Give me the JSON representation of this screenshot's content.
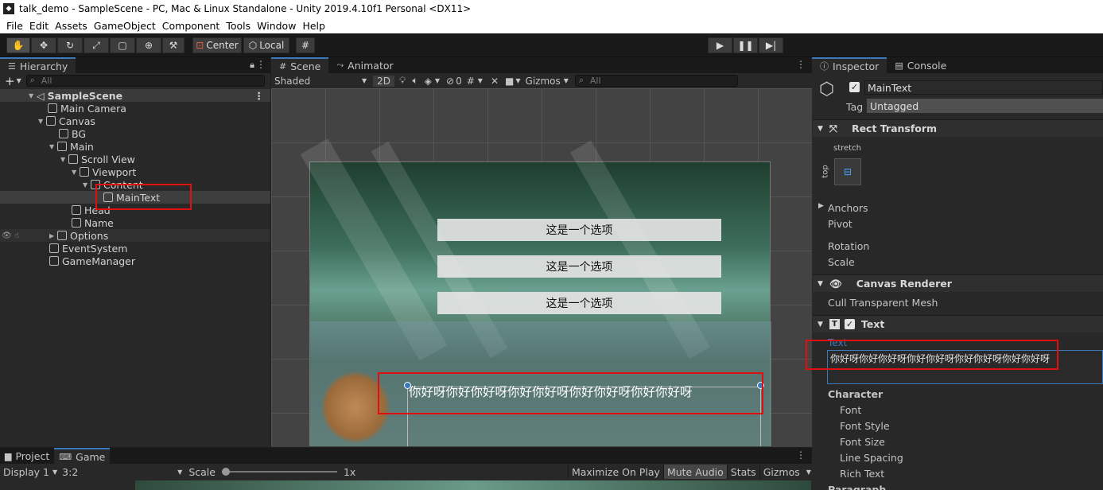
{
  "window": {
    "title": "talk_demo - SampleScene - PC, Mac & Linux Standalone - Unity 2019.4.10f1 Personal <DX11>"
  },
  "menu": [
    "File",
    "Edit",
    "Assets",
    "GameObject",
    "Component",
    "Tools",
    "Window",
    "Help"
  ],
  "toolbar": {
    "center_label": "Center",
    "local_label": "Local"
  },
  "hierarchy": {
    "tab": "Hierarchy",
    "add": "+",
    "search_placeholder": "All",
    "scene": "SampleScene",
    "items": [
      {
        "label": "Main Camera"
      },
      {
        "label": "Canvas"
      },
      {
        "label": "BG"
      },
      {
        "label": "Main"
      },
      {
        "label": "Scroll View"
      },
      {
        "label": "Viewport"
      },
      {
        "label": "Content"
      },
      {
        "label": "MainText"
      },
      {
        "label": "Head"
      },
      {
        "label": "Name"
      },
      {
        "label": "Options"
      },
      {
        "label": "EventSystem"
      },
      {
        "label": "GameManager"
      }
    ]
  },
  "scene": {
    "tabs": [
      "Scene",
      "Animator"
    ],
    "shading": "Shaded",
    "mode2d": "2D",
    "layers": "0",
    "gizmos": "Gizmos",
    "search_placeholder": "All",
    "options": [
      "这是一个选项",
      "这是一个选项",
      "这是一个选项"
    ],
    "dialog_text": "你好呀你好你好呀你好你好呀你好你好呀你好你好呀"
  },
  "inspector": {
    "tabs": [
      "Inspector",
      "Console"
    ],
    "object_name": "MainText",
    "tag_label": "Tag",
    "tag_value": "Untagged",
    "rect_transform": "Rect Transform",
    "anchor_x": "stretch",
    "anchor_y": "top",
    "rows1": [
      "Anchors",
      "Pivot",
      "Rotation",
      "Scale"
    ],
    "canvas_renderer": "Canvas Renderer",
    "cull": "Cull Transparent Mesh",
    "text_comp": "Text",
    "text_label": "Text",
    "text_value": "你好呀你好你好呀你好你好呀你好你好呀你好你好呀",
    "character": "Character",
    "char_rows": [
      "Font",
      "Font Style",
      "Font Size",
      "Line Spacing",
      "Rich Text"
    ],
    "paragraph": "Paragraph"
  },
  "game": {
    "tabs": [
      "Project",
      "Game"
    ],
    "display": "Display 1",
    "aspect": "3:2",
    "scale_label": "Scale",
    "scale_value": "1x",
    "buttons": [
      "Maximize On Play",
      "Mute Audio",
      "Stats",
      "Gizmos"
    ]
  },
  "colors": {
    "accent": "#3a79bb",
    "highlight": "#e01010"
  }
}
